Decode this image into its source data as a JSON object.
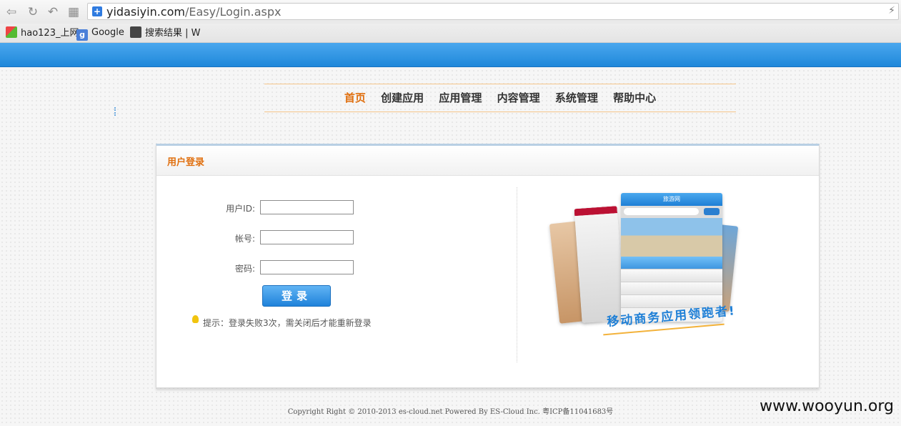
{
  "browser": {
    "url_host": "yidasiyin.com",
    "url_path": "/Easy/Login.aspx",
    "bookmarks": [
      {
        "label": "hao123_上网"
      },
      {
        "label": "Google"
      },
      {
        "label": "搜索结果 | W"
      }
    ]
  },
  "nav": {
    "items": [
      "首页",
      "创建应用",
      "应用管理",
      "内容管理",
      "系统管理",
      "帮助中心"
    ],
    "active_index": 0
  },
  "login": {
    "title": "用户登录",
    "userid_label": "用户ID:",
    "account_label": "帐号:",
    "password_label": "密码:",
    "userid_value": "",
    "account_value": "",
    "password_value": "",
    "button_label": "登录",
    "hint": "提示：登录失败3次，需关闭后才能重新登录"
  },
  "promo": {
    "app_title": "旅游网",
    "slogan": "移动商务应用领跑者!"
  },
  "footer": {
    "copyright": "Copyright Right © 2010-2013 es-cloud.net Powered By ES-Cloud Inc. 粤ICP备11041683号"
  },
  "watermark": "www.wooyun.org",
  "colors": {
    "accent_orange": "#e07010",
    "brand_blue": "#1f88da"
  }
}
